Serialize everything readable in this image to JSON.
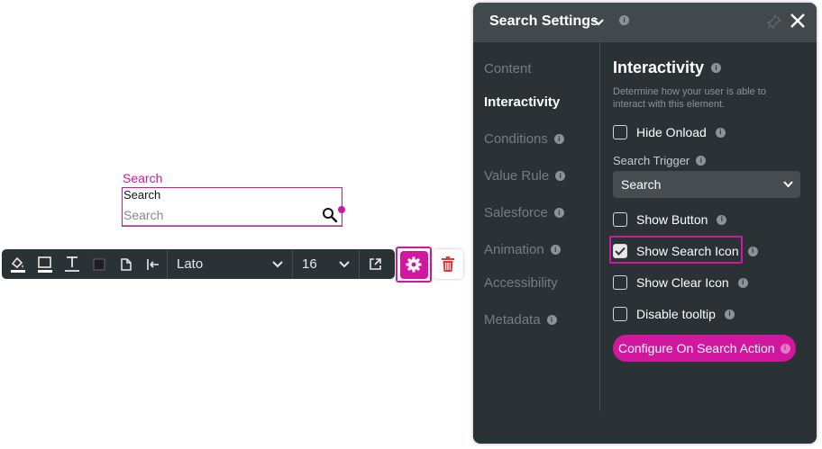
{
  "canvas": {
    "element_label": "Search",
    "field_title": "Search",
    "placeholder": "Search"
  },
  "toolbar": {
    "font": "Lato",
    "size": "16",
    "accent_color": "#d1169f"
  },
  "panel": {
    "title": "Search Settings",
    "nav": [
      {
        "label": "Content",
        "active": false,
        "info": false
      },
      {
        "label": "Interactivity",
        "active": true,
        "info": false
      },
      {
        "label": "Conditions",
        "active": false,
        "info": true
      },
      {
        "label": "Value Rule",
        "active": false,
        "info": true
      },
      {
        "label": "Salesforce",
        "active": false,
        "info": true
      },
      {
        "label": "Animation",
        "active": false,
        "info": true
      },
      {
        "label": "Accessibility",
        "active": false,
        "info": false
      },
      {
        "label": "Metadata",
        "active": false,
        "info": true
      }
    ],
    "section": {
      "title": "Interactivity",
      "description": "Determine how your user is able to interact with this element.",
      "hide_onload": {
        "label": "Hide Onload",
        "checked": false
      },
      "search_trigger": {
        "label": "Search Trigger",
        "value": "Search"
      },
      "show_button": {
        "label": "Show Button",
        "checked": false
      },
      "show_search_icon": {
        "label": "Show Search Icon",
        "checked": true
      },
      "show_clear_icon": {
        "label": "Show Clear Icon",
        "checked": false
      },
      "disable_tooltip": {
        "label": "Disable tooltip",
        "checked": false
      },
      "action_button": "Configure On Search Action"
    }
  },
  "info_glyph": "i"
}
